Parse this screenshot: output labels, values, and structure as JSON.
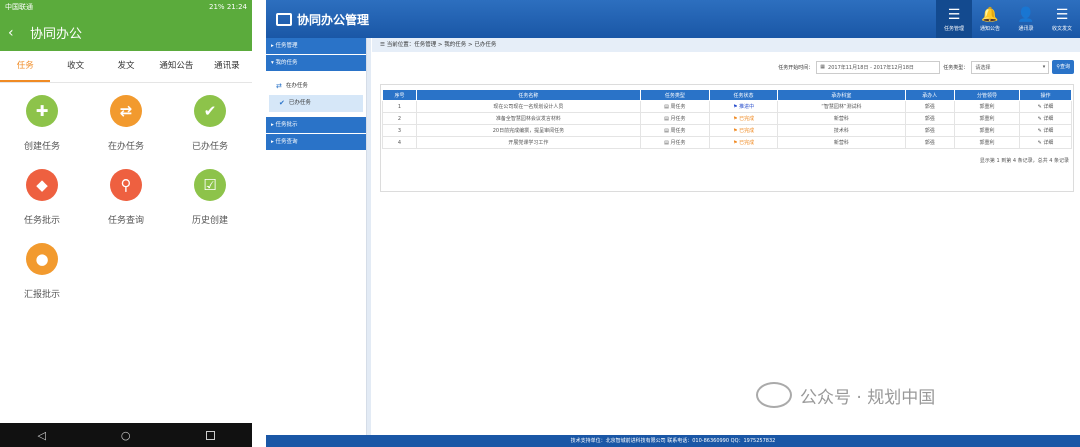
{
  "phone": {
    "status": {
      "carrier": "中国联通",
      "battery": "21%",
      "time": "21:24"
    },
    "title": "协同办公",
    "tabs": [
      "任务",
      "收文",
      "发文",
      "通知公告",
      "通讯录"
    ],
    "grid": [
      {
        "label": "创建任务",
        "icon": "plus-doc-icon",
        "color": "#8dc34a",
        "glyph": "✚"
      },
      {
        "label": "在办任务",
        "icon": "swap-arrows-icon",
        "color": "#f29a2e",
        "glyph": "⇄"
      },
      {
        "label": "已办任务",
        "icon": "check-circle-icon",
        "color": "#8dc34a",
        "glyph": "✔"
      },
      {
        "label": "任务批示",
        "icon": "cube-icon",
        "color": "#ee6040",
        "glyph": "◆"
      },
      {
        "label": "任务查询",
        "icon": "search-doc-icon",
        "color": "#ee6040",
        "glyph": "⚲"
      },
      {
        "label": "历史创建",
        "icon": "history-chart-icon",
        "color": "#8dc34a",
        "glyph": "☑"
      },
      {
        "label": "汇报批示",
        "icon": "user-report-icon",
        "color": "#f29a2e",
        "glyph": "●"
      }
    ]
  },
  "web": {
    "header": {
      "title": "协同办公管理"
    },
    "topnav": [
      {
        "label": "任务管理",
        "glyph": "☰",
        "icon": "list-icon"
      },
      {
        "label": "通知公告",
        "glyph": "🔔",
        "icon": "bell-icon"
      },
      {
        "label": "通讯录",
        "glyph": "👤",
        "icon": "contacts-icon"
      },
      {
        "label": "收文发文",
        "glyph": "☰",
        "icon": "document-list-icon"
      }
    ],
    "sidebar": {
      "group1": "任务管理",
      "group2": "我的任务",
      "item1": "在办任务",
      "item2": "已办任务",
      "group3": "任务批示",
      "group4": "任务查询"
    },
    "breadcrumb": "当前位置：任务管理 > 我的任务 > 已办任务",
    "filter": {
      "start_label": "任务开始时间：",
      "date_range": "2017年11月18日 - 2017年12月18日",
      "type_label": "任务类型：",
      "type_value": "请选择",
      "query_button": "查询"
    },
    "table": {
      "headers": [
        "序号",
        "任务名称",
        "任务类型",
        "任务状态",
        "承办科室",
        "承办人",
        "分管领导",
        "操作"
      ],
      "rows": [
        {
          "no": "1",
          "name": "现在公司现在一名规划设计人员",
          "type": "周任务",
          "status": "推进中",
          "status_class": "status-blue",
          "dept": "“智慧园林”测试科",
          "person": "郭强",
          "leader": "郭重利",
          "op": "详细"
        },
        {
          "no": "2",
          "name": "准备全智慧园林会议发言材料",
          "type": "月任务",
          "status": "已完成",
          "status_class": "status-orange",
          "dept": "新营科",
          "person": "郭强",
          "leader": "郭重利",
          "op": "详细"
        },
        {
          "no": "3",
          "name": "20日前完成编撰，提呈审阅任务",
          "type": "周任务",
          "status": "已完成",
          "status_class": "status-orange",
          "dept": "技术科",
          "person": "郭强",
          "leader": "郭重利",
          "op": "详细"
        },
        {
          "no": "4",
          "name": "开展党课学习工作",
          "type": "月任务",
          "status": "已完成",
          "status_class": "status-orange",
          "dept": "新营科",
          "person": "郭强",
          "leader": "郭重利",
          "op": "详细"
        }
      ]
    },
    "pageinfo": "显示第 1 到第 4 条记录，总共 4 条记录",
    "footer": "技术支持单位：北京智城前进科技有限公司   联系电话：010-86360990   QQ：1975257832"
  },
  "watermark": "公众号 · 规划中国"
}
